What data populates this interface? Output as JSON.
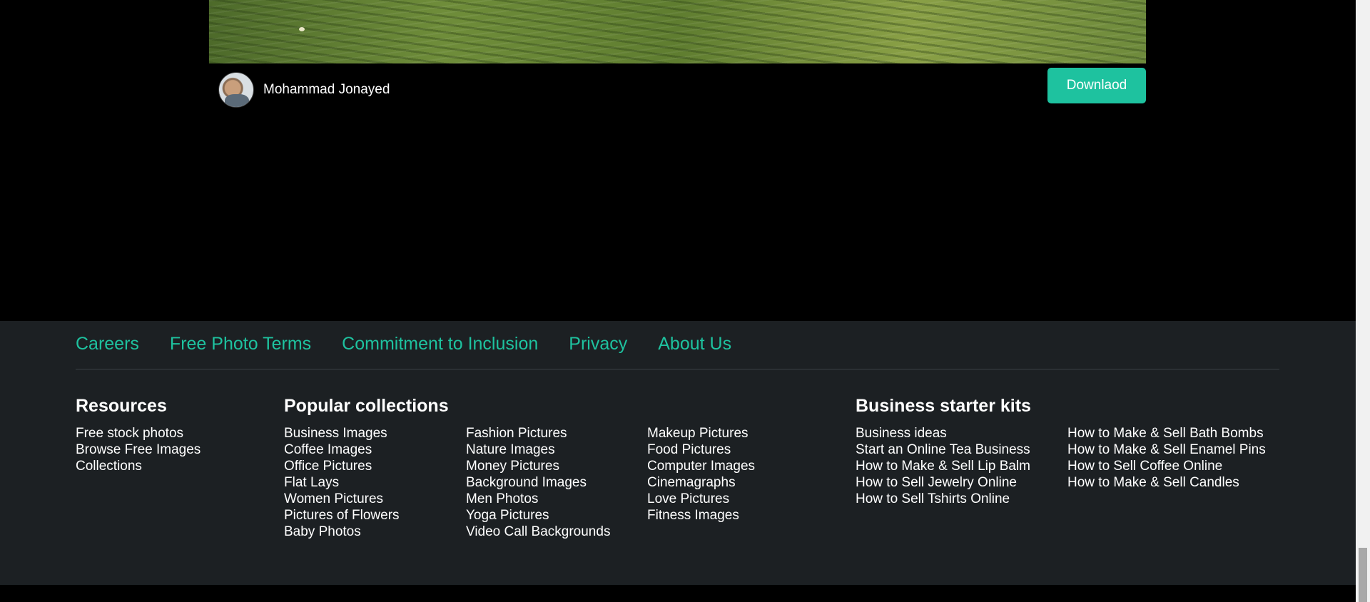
{
  "photo": {
    "author": "Mohammad Jonayed",
    "download_label": "Downlaod"
  },
  "footer": {
    "nav": [
      "Careers",
      "Free Photo Terms",
      "Commitment to Inclusion",
      "Privacy",
      "About Us"
    ],
    "resources": {
      "title": "Resources",
      "links": [
        "Free stock photos",
        "Browse Free Images",
        "Collections"
      ]
    },
    "popular": {
      "title": "Popular collections",
      "col1": [
        "Business Images",
        "Coffee Images",
        "Office Pictures",
        "Flat Lays",
        "Women Pictures",
        "Pictures of Flowers",
        "Baby Photos"
      ],
      "col2": [
        "Fashion Pictures",
        "Nature Images",
        "Money Pictures",
        "Background Images",
        "Men Photos",
        "Yoga Pictures",
        "Video Call Backgrounds"
      ],
      "col3": [
        "Makeup Pictures",
        "Food Pictures",
        "Computer Images",
        "Cinemagraphs",
        "Love Pictures",
        "Fitness Images"
      ]
    },
    "business": {
      "title": "Business starter kits",
      "col1": [
        "Business ideas",
        "Start an Online Tea Business",
        "How to Make & Sell Lip Balm",
        "How to Sell Jewelry Online",
        "How to Sell Tshirts Online"
      ],
      "col2": [
        "How to Make & Sell Bath Bombs",
        "How to Make & Sell Enamel Pins",
        "How to Sell Coffee Online",
        "How to Make & Sell Candles"
      ]
    }
  },
  "colors": {
    "accent": "#1ec29f",
    "footer_bg": "#1c2023",
    "page_bg": "#000000"
  }
}
